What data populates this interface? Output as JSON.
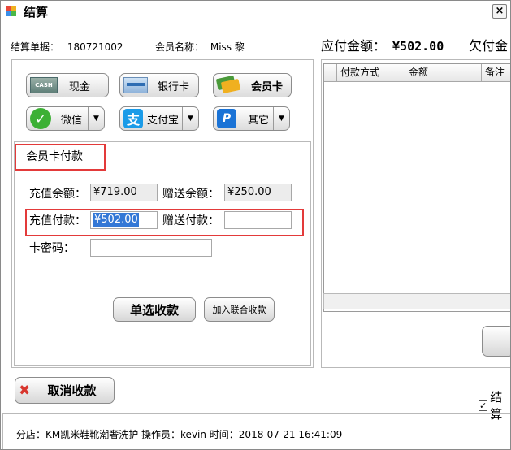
{
  "window": {
    "title": "结算",
    "close_glyph": "×"
  },
  "header": {
    "order_label": "结算单据：",
    "order_no": "180721002",
    "member_label": "会员名称：",
    "member_name": "Miss 黎",
    "due_label": "应付金额：",
    "due_amount": "¥502.00",
    "owed_label": "欠付金"
  },
  "payment_methods": {
    "cash": "现金",
    "bank_card": "银行卡",
    "member_card": "会员卡",
    "wechat": "微信",
    "alipay": "支付宝",
    "other": "其它",
    "cash_icon_text": "CASH",
    "wechat_icon_glyph": "✓",
    "alipay_icon_glyph": "支",
    "other_icon_glyph": "P",
    "dropdown_glyph": "▼"
  },
  "member_card_section": {
    "title": "会员卡付款",
    "balance_label": "充值余额：",
    "balance_value": "¥719.00",
    "bonus_balance_label": "赠送余额：",
    "bonus_balance_value": "¥250.00",
    "pay_label": "充值付款：",
    "pay_value": "¥502.00",
    "bonus_pay_label": "赠送付款：",
    "bonus_pay_value": "",
    "password_label": "卡密码：",
    "password_value": ""
  },
  "actions": {
    "single_pay": "单选收款",
    "add_combined": "加入联合收款",
    "cancel": "取消收款",
    "cancel_icon_glyph": "✖"
  },
  "payments_table": {
    "columns": [
      "付款方式",
      "金额",
      "备注"
    ]
  },
  "options": {
    "settle_checkbox_label": "结算",
    "settle_checked": true,
    "check_glyph": "✓"
  },
  "status": {
    "text": "分店：KM凯米鞋靴潮奢洗护   操作员：kevin   时间：2018-07-21 16:41:09"
  },
  "colors": {
    "highlight_red": "#e33a3a",
    "selection_blue": "#3478d6",
    "wechat_green": "#3cb035",
    "alipay_blue": "#1a9be8"
  }
}
